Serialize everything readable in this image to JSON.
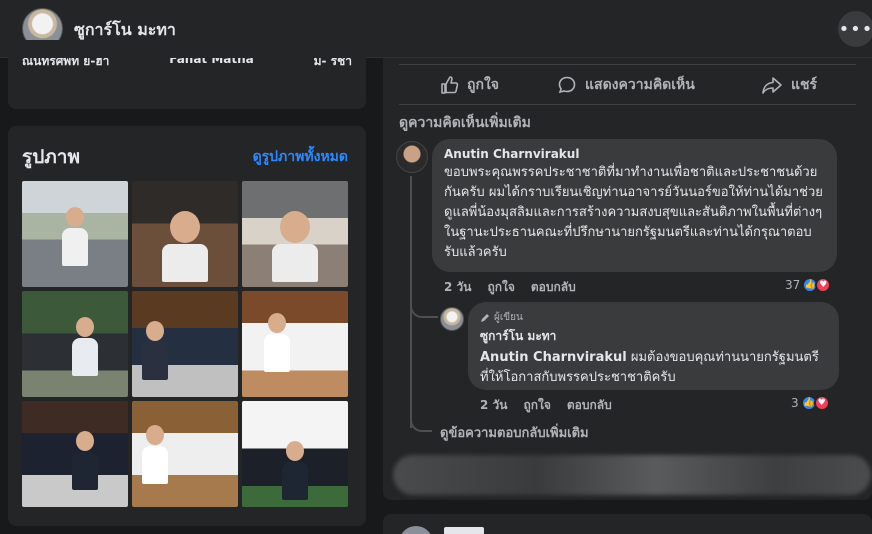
{
  "header": {
    "profile_name": "ซูการ์โน มะทา",
    "more_icon": "more-horizontal-icon"
  },
  "friends": {
    "names": [
      "ณนทรศพท์ ย-ฮา",
      "Fahat Matha",
      "ม- รชา"
    ]
  },
  "photos": {
    "title": "รูปภาพ",
    "see_all": "ดูรูปภาพทั้งหมด",
    "count": 9
  },
  "post_actions": {
    "like": "ถูกใจ",
    "comment": "แสดงความคิดเห็น",
    "share": "แชร์"
  },
  "comments": {
    "view_more": "ดูความคิดเห็นเพิ่มเติม",
    "items": [
      {
        "author": "Anutin Charnvirakul",
        "text": "ขอบพระคุณพรรคประชาชาติที่มาทำงานเพื่อชาติและประชาชนด้วยกันครับ ผมได้กราบเรียนเชิญท่านอาจารย์วันนอร์ขอให้ท่านได้มาช่วยดูแลพี่น้องมุสลิมและการสร้างความสงบสุขและสันติภาพในพื้นที่ต่างๆในฐานะประธานคณะที่ปรึกษานายกรัฐมนตรีและท่านได้กรุณาตอบรับแล้วครับ",
        "age": "2 วัน",
        "like_label": "ถูกใจ",
        "reply_label": "ตอบกลับ",
        "reaction_count": "37"
      }
    ],
    "reply": {
      "badge": "ผู้เขียน",
      "author": "ซูการ์โน มะทา",
      "mention": "Anutin Charnvirakul",
      "text": " ผมต้องขอบคุณท่านนายกรัฐมนตรีที่ให้โอกาสกับพรรคประชาชาติครับ",
      "age": "2 วัน",
      "like_label": "ถูกใจ",
      "reply_label": "ตอบกลับ",
      "reaction_count": "3"
    },
    "view_more_replies": "ดูข้อความตอบกลับเพิ่มเติม"
  }
}
